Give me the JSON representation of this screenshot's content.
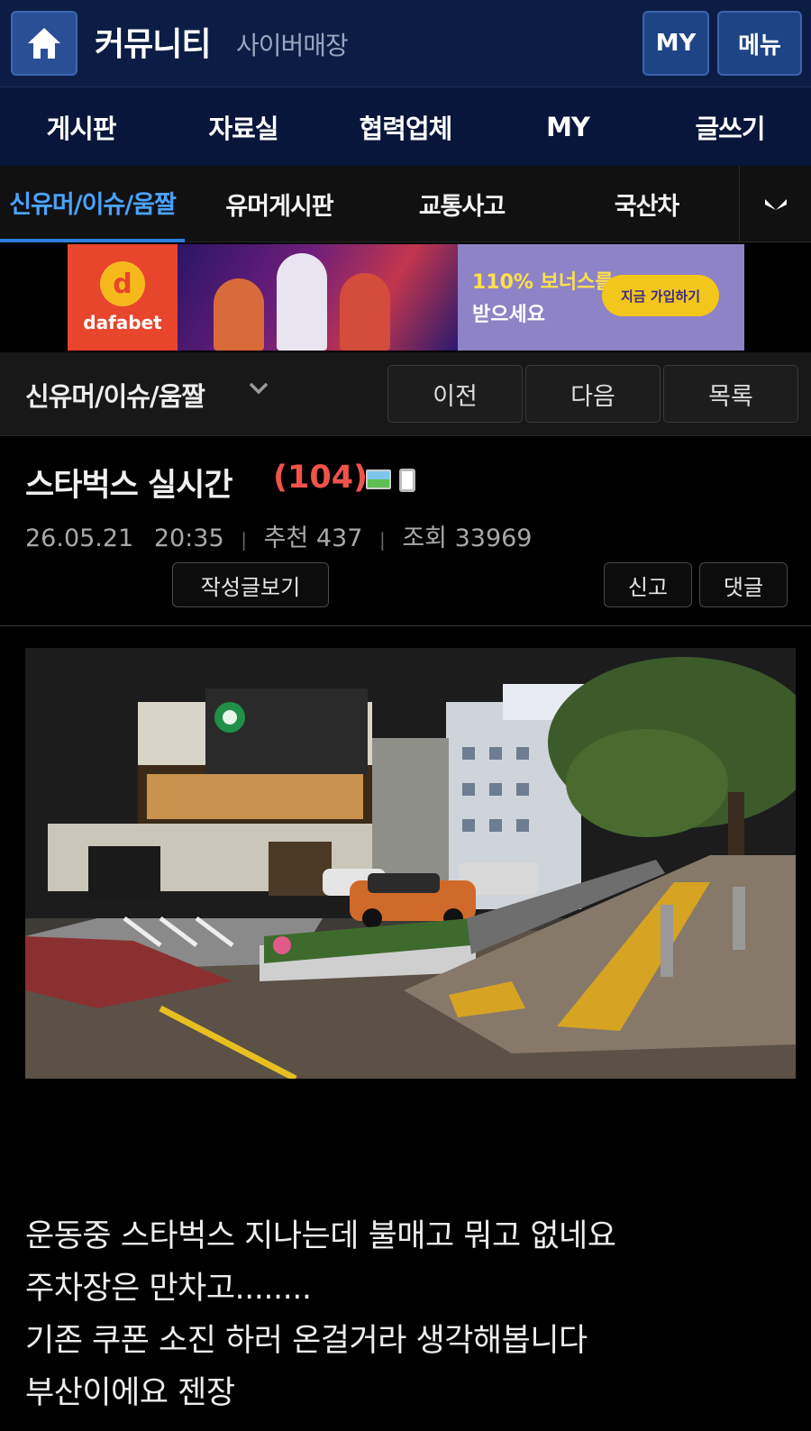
{
  "header": {
    "brand": "커뮤니티",
    "brand_sub": "사이버매장",
    "my_label": "MY",
    "menu_label": "메뉴"
  },
  "main_nav": [
    "게시판",
    "자료실",
    "협력업체",
    "MY",
    "글쓰기"
  ],
  "sub_nav": {
    "tabs": [
      "신유머/이슈/움짤",
      "유머게시판",
      "교통사고",
      "국산차"
    ],
    "active_index": 0
  },
  "banner": {
    "brand": "dafabet",
    "headline_line1": "110% 보너스를",
    "headline_line2": "받으세요",
    "cta": "지금 가입하기"
  },
  "board_bar": {
    "board_name": "신유머/이슈/움짤",
    "prev_label": "이전",
    "next_label": "다음",
    "list_label": "목록"
  },
  "post": {
    "title": "스타벅스 실시간",
    "comment_count": "(104)",
    "date": "26.05.21",
    "time": "20:35",
    "recommend_label": "추천 437",
    "views_label": "조회 33969",
    "author_posts_label": "작성글보기",
    "report_label": "신고",
    "comment_label": "댓글",
    "body_lines": [
      "운동중 스타벅스 지나는데 불매고 뭐고 없네요",
      "주차장은 만차고........",
      "기존 쿠폰 소진 하러 온걸거라 생각해봅니다",
      "부산이에요 젠장"
    ]
  },
  "colors": {
    "header_bg": "#0b1d44",
    "nav_bg": "#07163a",
    "active_tab": "#4aa3ff",
    "count_red": "#f0534a"
  }
}
